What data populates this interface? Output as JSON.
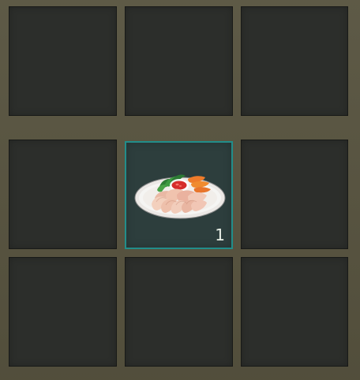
{
  "inventory": {
    "selected_item": {
      "icon": "meat-platter-icon",
      "count": "1"
    }
  }
}
